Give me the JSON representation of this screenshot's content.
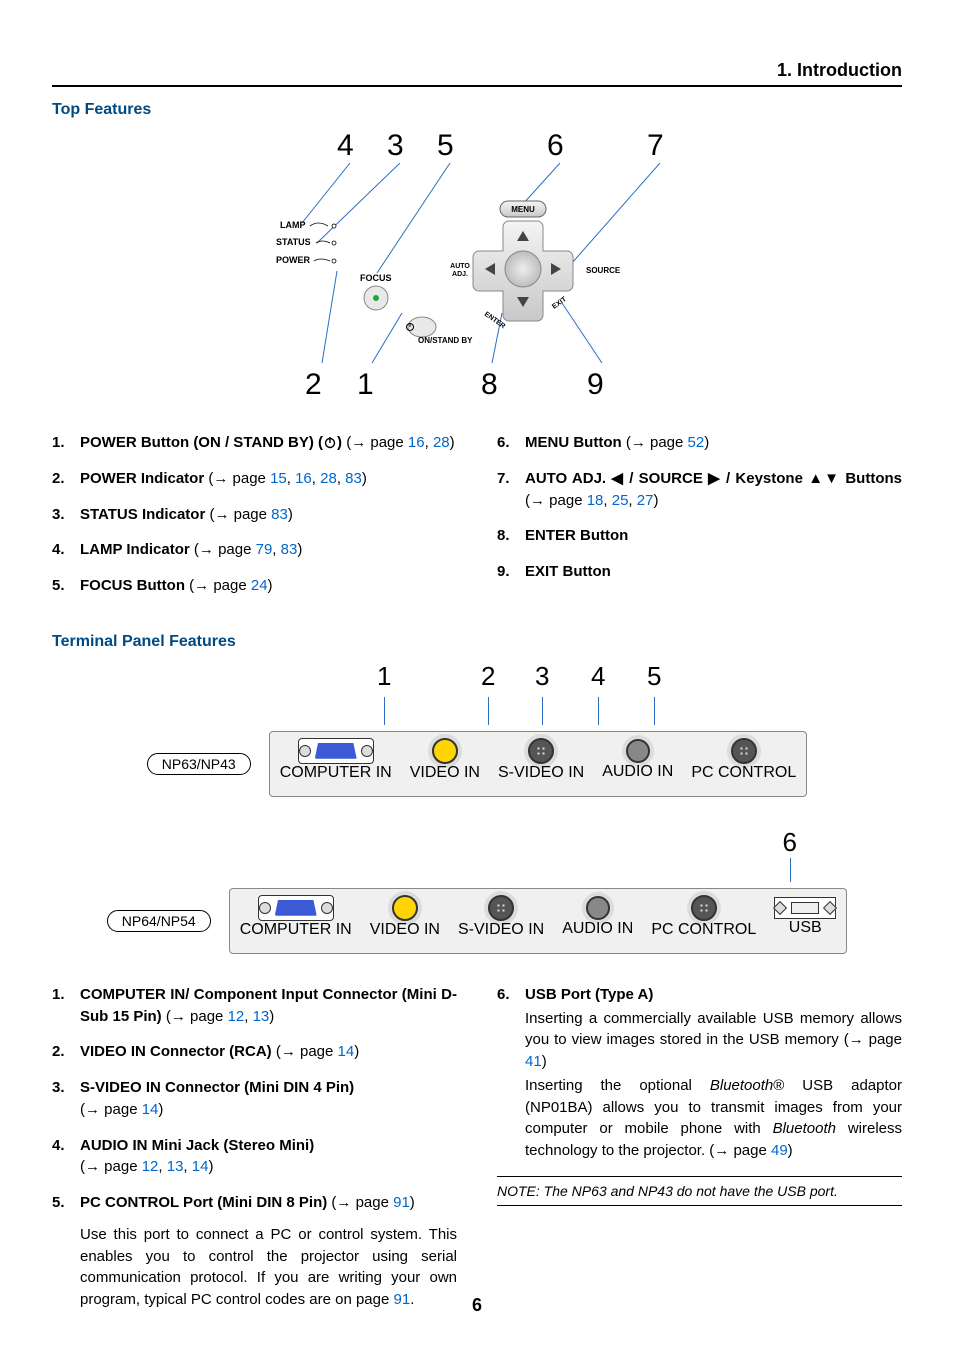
{
  "chapter_header": "1. Introduction",
  "section_top": "Top Features",
  "section_terminal": "Terminal Panel Features",
  "top_callouts_upper": [
    "4",
    "3",
    "5",
    "6",
    "7"
  ],
  "top_callouts_lower": [
    "2",
    "1",
    "8",
    "9"
  ],
  "top_panel_labels": {
    "lamp": "LAMP",
    "status": "STATUS",
    "power": "POWER",
    "focus": "FOCUS",
    "menu": "MENU",
    "auto": "AUTO\nADJ.",
    "source": "SOURCE",
    "enter": "ENTER",
    "exit": "EXIT",
    "onstandby": "ON/STAND BY"
  },
  "left_items": [
    {
      "n": "1.",
      "title": "POWER Button (ON / STAND BY) (",
      "title_after": ")",
      "ref_prefix": " (→ page ",
      "pages": [
        "16",
        "28"
      ],
      "ref_suffix": ")"
    },
    {
      "n": "2.",
      "title": "POWER Indicator",
      "ref_prefix": " (→ page ",
      "pages": [
        "15",
        "16",
        "28",
        "83"
      ],
      "ref_suffix": ")"
    },
    {
      "n": "3.",
      "title": "STATUS Indicator",
      "ref_prefix": " (→ page ",
      "pages": [
        "83"
      ],
      "ref_suffix": ")"
    },
    {
      "n": "4.",
      "title": "LAMP Indicator",
      "ref_prefix": " (→ page ",
      "pages": [
        "79",
        "83"
      ],
      "ref_suffix": ")"
    },
    {
      "n": "5.",
      "title": "FOCUS Button",
      "ref_prefix": " (→ page ",
      "pages": [
        "24"
      ],
      "ref_suffix": ")"
    }
  ],
  "right_items": [
    {
      "n": "6.",
      "title": "MENU Button",
      "ref_prefix": " (→ page ",
      "pages": [
        "52"
      ],
      "ref_suffix": ")"
    },
    {
      "n": "7.",
      "title": "AUTO ADJ. ◀ / SOURCE ▶ / Keystone ▲▼ Buttons",
      "ref_prefix": " (→ page ",
      "pages": [
        "18",
        "25",
        "27"
      ],
      "ref_suffix": ")"
    },
    {
      "n": "8.",
      "title": "ENTER Button"
    },
    {
      "n": "9.",
      "title": "EXIT Button"
    }
  ],
  "models": {
    "a": "NP63/NP43",
    "b": "NP64/NP54"
  },
  "term_callouts": [
    "1",
    "2",
    "3",
    "4",
    "5"
  ],
  "term_callout6": "6",
  "port_labels": {
    "computer": "COMPUTER IN",
    "video": "VIDEO IN",
    "svideo": "S-VIDEO IN",
    "audio": "AUDIO IN",
    "pc": "PC CONTROL",
    "usb": "USB"
  },
  "term_left": [
    {
      "n": "1.",
      "title": "COMPUTER IN/ Component Input Connector (Mini D-Sub 15 Pin)",
      "ref_prefix": " (→ page ",
      "pages": [
        "12",
        "13"
      ],
      "ref_suffix": ")"
    },
    {
      "n": "2.",
      "title": "VIDEO IN Connector (RCA)",
      "ref_prefix": " (→ page ",
      "pages": [
        "14"
      ],
      "ref_suffix": ")"
    },
    {
      "n": "3.",
      "title": "S-VIDEO IN Connector (Mini DIN 4 Pin)",
      "ref_inline": false,
      "ref_prefix": "(→ page ",
      "pages": [
        "14"
      ],
      "ref_suffix": ")"
    },
    {
      "n": "4.",
      "title": "AUDIO IN Mini Jack (Stereo Mini)",
      "ref_inline": false,
      "ref_prefix": "(→ page ",
      "pages": [
        "12",
        "13",
        "14"
      ],
      "ref_suffix": ")"
    },
    {
      "n": "5.",
      "title": "PC CONTROL Port (Mini DIN 8 Pin)",
      "ref_prefix": " (→ page ",
      "pages": [
        "91"
      ],
      "ref_suffix": ")",
      "desc": "Use this port to connect a PC or control system. This enables you to control the projector using serial communication protocol. If you are writing your own program, typical PC control codes are on page ",
      "desc_page": "91",
      "desc_after": "."
    }
  ],
  "term_right": {
    "n": "6.",
    "title": "USB Port (Type A)",
    "p1a": "Inserting a commercially available USB memory allows you to view images stored in the USB memory (→ page ",
    "p1_page": "41",
    "p1b": ")",
    "p2a": "Inserting the optional ",
    "p2_it": "Bluetooth",
    "p2_reg": "®",
    "p2b": " USB adaptor (NP01BA) allows you to transmit images from your computer or mobile phone with ",
    "p2_it2": "Bluetooth",
    "p2c": " wireless technology to the projector. (→ page ",
    "p2_page": "49",
    "p2d": ")"
  },
  "note": "NOTE: The NP63 and NP43 do not have the USB port.",
  "page_number": "6"
}
